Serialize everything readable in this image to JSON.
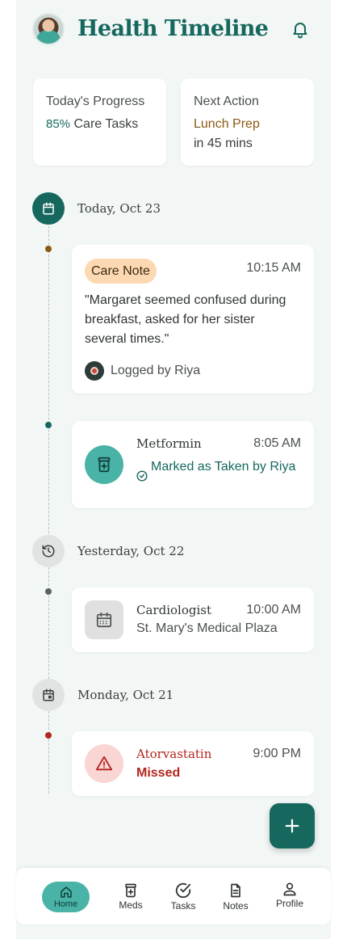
{
  "header": {
    "title": "Health Timeline"
  },
  "summary": {
    "progress": {
      "label": "Today's Progress",
      "percent": "85%",
      "text": "Care Tasks"
    },
    "next_action": {
      "label": "Next Action",
      "item": "Lunch Prep",
      "eta": "in 45 mins"
    }
  },
  "timeline": {
    "today": {
      "date": "Today, Oct 23",
      "note": {
        "badge": "Care Note",
        "time": "10:15 AM",
        "text": "\"Margaret seemed confused during breakfast, asked for her sister several times.\"",
        "logged_by": "Logged by Riya"
      },
      "med": {
        "name": "Metformin",
        "time": "8:05 AM",
        "status": "Marked as Taken by Riya"
      }
    },
    "yesterday": {
      "date": "Yesterday, Oct 22",
      "appointment": {
        "name": "Cardiologist",
        "time": "10:00 AM",
        "location": "St. Mary's Medical Plaza"
      }
    },
    "monday": {
      "date": "Monday, Oct 21",
      "med": {
        "name": "Atorvastatin",
        "time": "9:00 PM",
        "status": "Missed"
      }
    }
  },
  "fab": {
    "icon": "plus-icon"
  },
  "nav": {
    "home": "Home",
    "meds": "Meds",
    "tasks": "Tasks",
    "notes": "Notes",
    "profile": "Profile"
  },
  "colors": {
    "accent": "#16685e",
    "amber": "#8a5a12",
    "danger": "#b3261e",
    "badge_bg": "#fdd9b3",
    "background": "#f2f6f5"
  }
}
